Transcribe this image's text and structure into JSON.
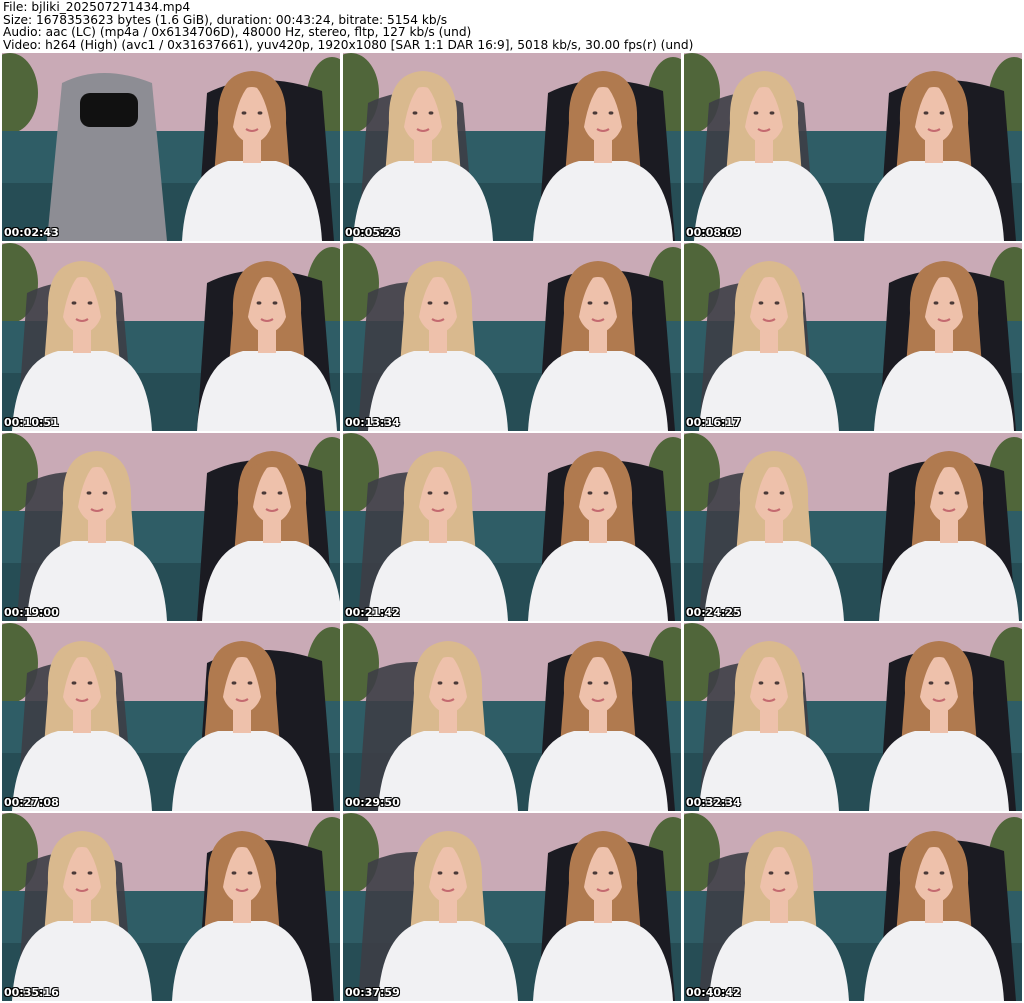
{
  "header": {
    "file_line": "File: bjliki_202507271434.mp4",
    "size_line": "Size: 1678353623 bytes (1.6 GiB), duration: 00:43:24, bitrate: 5154 kb/s",
    "audio_line": "Audio: aac (LC) (mp4a / 0x6134706D), 48000 Hz, stereo, fltp, 127 kb/s (und)",
    "video_line": "Video: h264 (High) (avc1 / 0x31637661), yuv420p, 1920x1080 [SAR 1:1 DAR 16:9], 5018 kb/s, 30.00 fps(r) (und)"
  },
  "thumbnails": [
    {
      "timestamp": "00:02:43"
    },
    {
      "timestamp": "00:05:26"
    },
    {
      "timestamp": "00:08:09"
    },
    {
      "timestamp": "00:10:51"
    },
    {
      "timestamp": "00:13:34"
    },
    {
      "timestamp": "00:16:17"
    },
    {
      "timestamp": "00:19:00"
    },
    {
      "timestamp": "00:21:42"
    },
    {
      "timestamp": "00:24:25"
    },
    {
      "timestamp": "00:27:08"
    },
    {
      "timestamp": "00:29:50"
    },
    {
      "timestamp": "00:32:34"
    },
    {
      "timestamp": "00:35:16"
    },
    {
      "timestamp": "00:37:59"
    },
    {
      "timestamp": "00:40:42"
    }
  ],
  "colors": {
    "wall": "#c9aab6",
    "sofa": "#2f5d66",
    "chair": "#1b1b22",
    "shirt": "#f1f1f3",
    "blonde_hair": "#d9b98e",
    "brown_hair": "#b07a4f",
    "skin": "#eec1ab",
    "plant": "#3b5a25"
  }
}
